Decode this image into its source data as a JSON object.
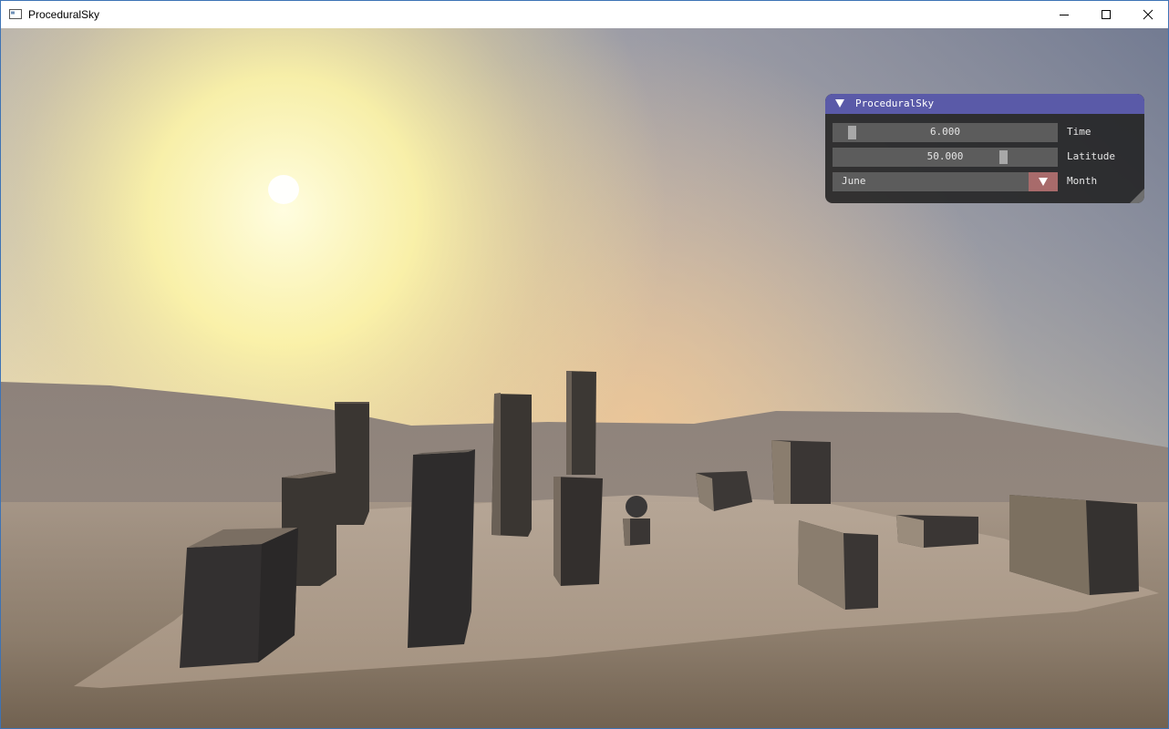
{
  "window": {
    "title": "ProceduralSky",
    "icon": "app-window-icon",
    "controls": {
      "minimize_icon": "minimize-icon",
      "maximize_icon": "maximize-icon",
      "close_icon": "close-icon"
    }
  },
  "panel": {
    "title": "ProceduralSky",
    "time": {
      "label": "Time",
      "value": "6.000"
    },
    "latitude": {
      "label": "Latitude",
      "value": "50.000"
    },
    "month": {
      "label": "Month",
      "value": "June"
    }
  },
  "colors": {
    "panel_title_bg": "#5a5aa8",
    "combo_button": "#a86b6b",
    "sky_top": "#6f7890",
    "horizon_glow": "#fff3a0",
    "ground": "#8a7a68"
  }
}
